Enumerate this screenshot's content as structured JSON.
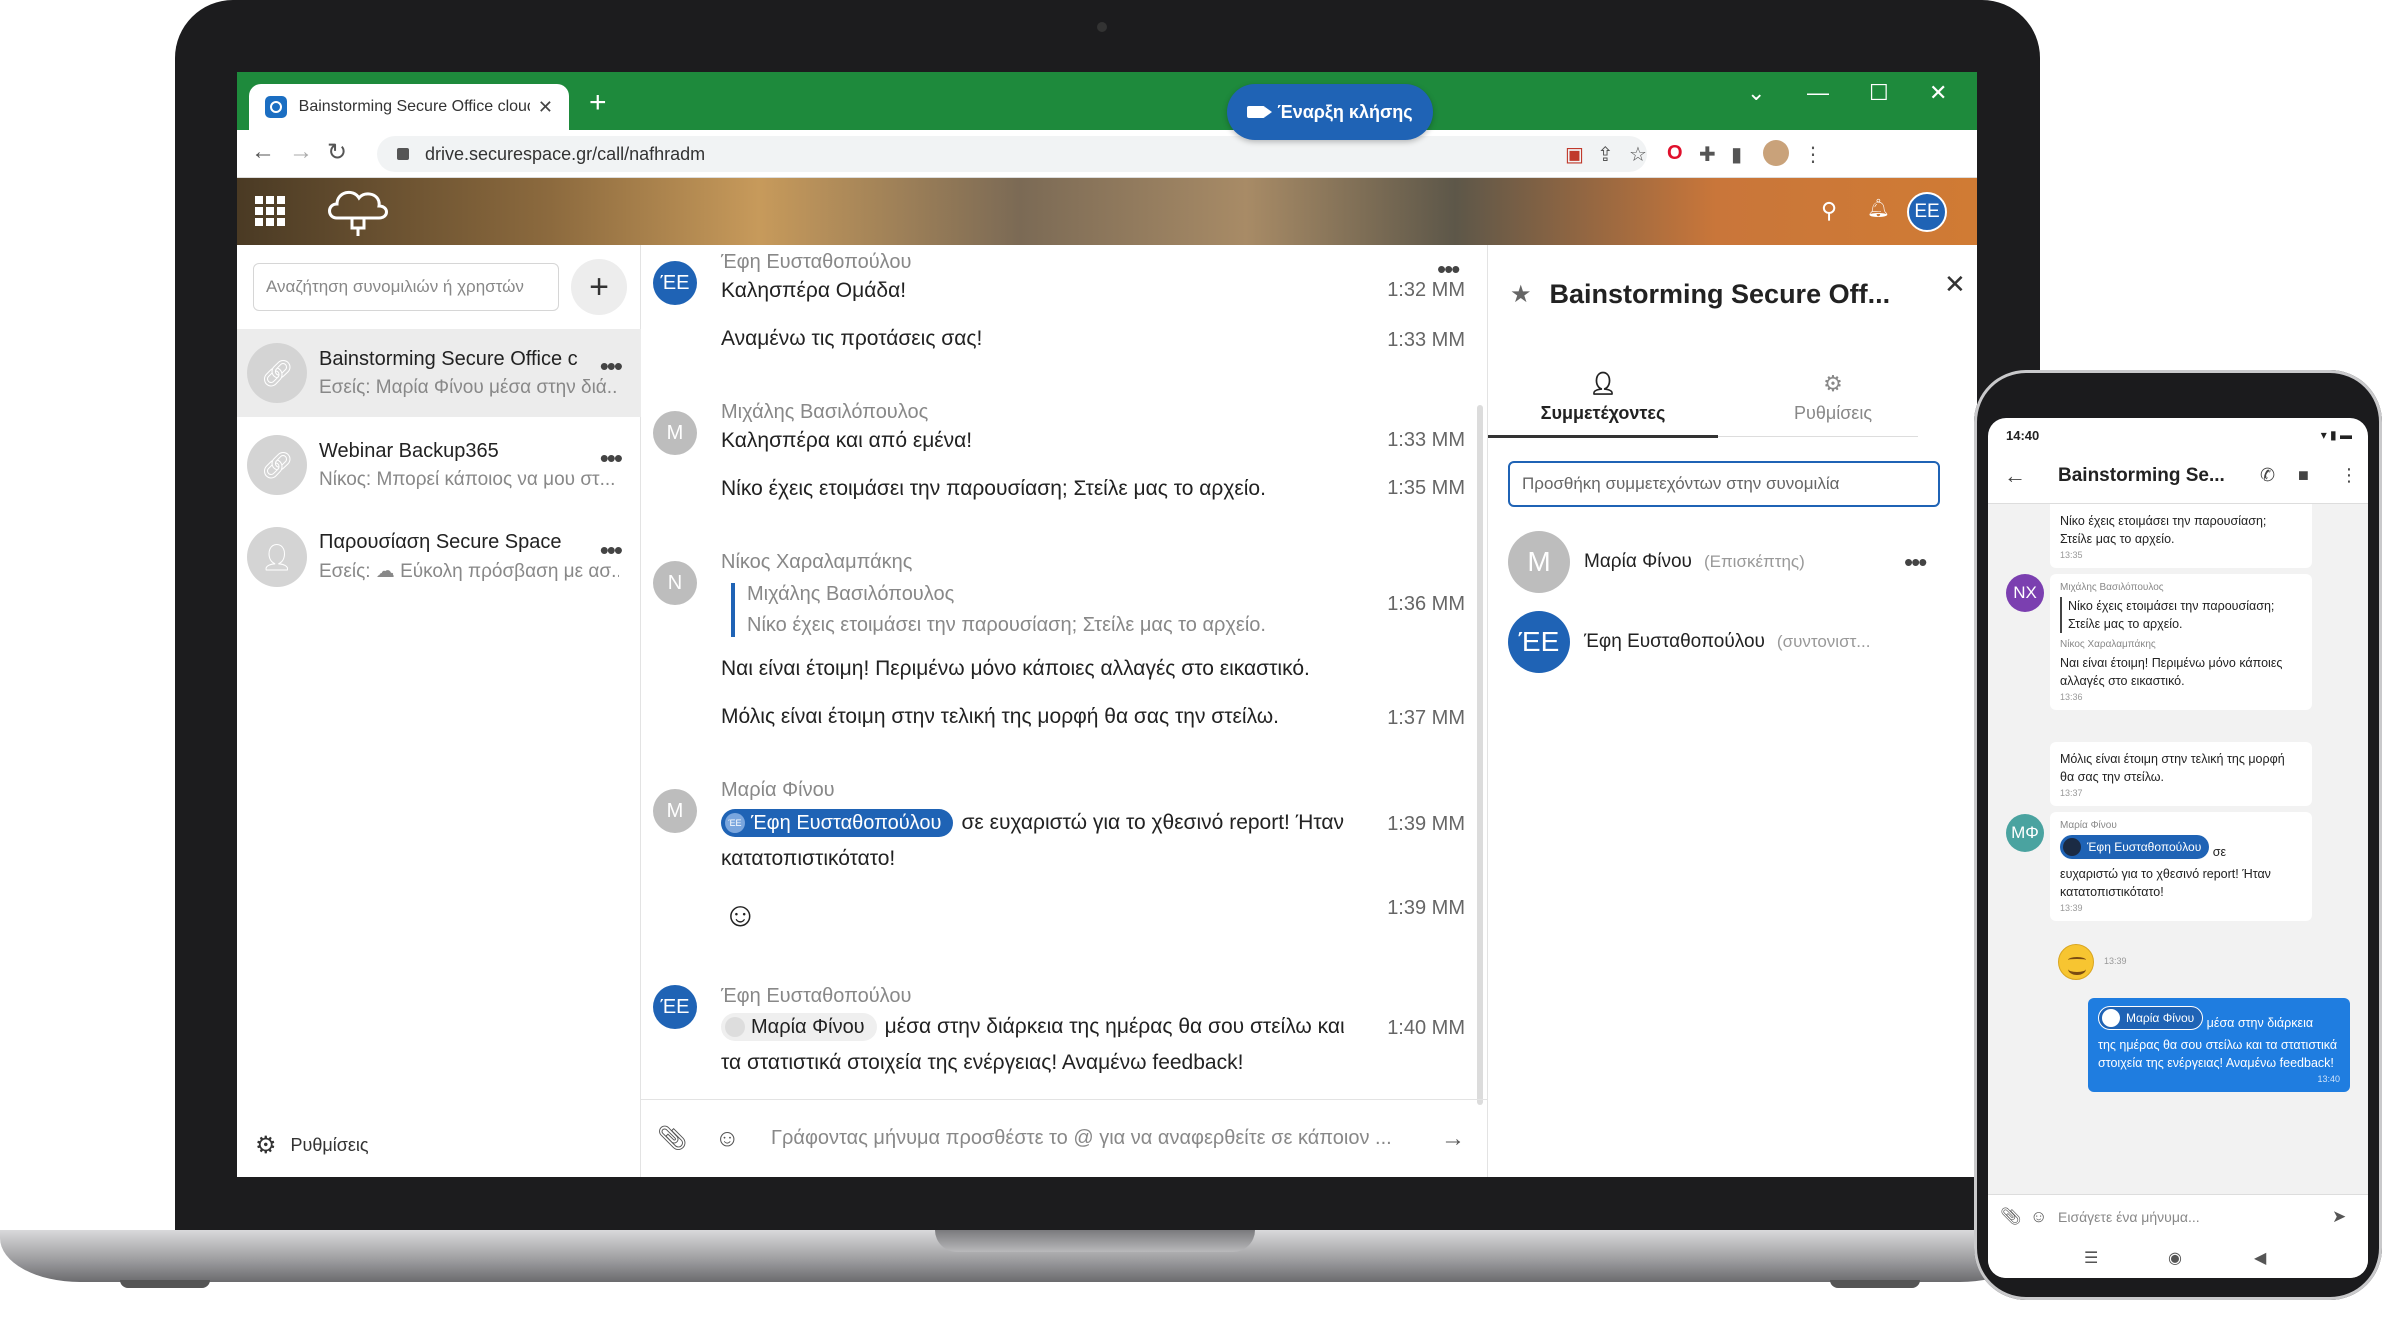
{
  "browser": {
    "tab_title": "Bainstorming Secure Office cloud",
    "tab_close": "✕",
    "new_tab": "+",
    "url": "drive.securespace.gr/call/nafhradm",
    "controls": {
      "chevron": "⌄",
      "minimize": "—",
      "maximize": "☐",
      "close": "✕"
    }
  },
  "app": {
    "header": {
      "avatar": "ΕΕ"
    }
  },
  "sidebar": {
    "search_placeholder": "Αναζήτηση συνομιλιών ή χρηστών",
    "add_label": "+",
    "conversations": [
      {
        "name": "Bainstorming Secure Office c...",
        "sub": "Εσείς: Μαρία Φίνου μέσα στην διά..."
      },
      {
        "name": "Webinar Backup365",
        "sub": "Νίκος: Μπορεί κάποιος να μου στ..."
      },
      {
        "name": "Παρουσίαση Secure Space",
        "sub": "Εσείς:  ☁ Εύκολη πρόσβαση με ασ..."
      }
    ],
    "settings_label": "Ρυθμίσεις"
  },
  "chat": {
    "call_button": "Έναρξη κλήσης",
    "messages": {
      "m1_author": "Έφη Ευσταθοπούλου",
      "m1_avatar": "ΈΕ",
      "m1_text": "Καλησπέρα Ομάδα!",
      "m1_time": "1:32 ΜΜ",
      "m2_text": "Αναμένω τις προτάσεις σας!",
      "m2_time": "1:33 ΜΜ",
      "m3_author": "Μιχάλης Βασιλόπουλος",
      "m3_avatar": "Μ",
      "m3_text": "Καλησπέρα και από εμένα!",
      "m3_time": "1:33 ΜΜ",
      "m4_text": "Νίκο έχεις ετοιμάσει την παρουσίαση; Στείλε μας το αρχείο.",
      "m4_time": "1:35 ΜΜ",
      "m5_author": "Νίκος Χαραλαμπάκης",
      "m5_avatar": "Ν",
      "m5_quote_author": "Μιχάλης Βασιλόπουλος",
      "m5_quote_text": "Νίκο έχεις ετοιμάσει την παρουσίαση; Στείλε μας το αρχείο.",
      "m5_text": "Ναι είναι έτοιμη! Περιμένω μόνο κάποιες αλλαγές στο εικαστικό.",
      "m5_time": "1:36 ΜΜ",
      "m6_text": "Μόλις είναι έτοιμη στην τελική της μορφή θα σας την στείλω.",
      "m6_time": "1:37 ΜΜ",
      "m7_author": "Μαρία Φίνου",
      "m7_avatar": "Μ",
      "m7_mention": "Έφη Ευσταθοπούλου",
      "m7_mention_av": "ΈΕ",
      "m7_text1": "σε ευχαριστώ για το χθεσινό report! Ήταν",
      "m7_text2": "κατατοπιστικότατο!",
      "m7_time": "1:39 ΜΜ",
      "m8_text": "☺",
      "m8_time": "1:39 ΜΜ",
      "m9_author": "Έφη Ευσταθοπούλου",
      "m9_avatar": "ΈΕ",
      "m9_mention": "Μαρία Φίνου",
      "m9_text1": "μέσα στην διάρκεια της ημέρας θα σου στείλω και",
      "m9_text2": "τα στατιστικά στοιχεία της ενέργειας! Αναμένω feedback!",
      "m9_time": "1:40 ΜΜ"
    },
    "composer_placeholder": "Γράφοντας μήνυμα προσθέστε το @ για να αναφερθείτε σε κάποιον ..."
  },
  "right_panel": {
    "title": "Bainstorming Secure Off...",
    "tabs": [
      "Συμμετέχοντες",
      "Ρυθμίσεις"
    ],
    "add_placeholder": "Προσθήκη συμμετεχόντων στην συνομιλία",
    "participants": [
      {
        "avatar": "Μ",
        "name": "Μαρία Φίνου",
        "role": "(Επισκέπτης)",
        "color": "#bdbdbd"
      },
      {
        "avatar": "ΈΕ",
        "name": "Έφη Ευσταθοπούλου",
        "role": "(συντονιστ...",
        "color": "#1f63b5"
      }
    ]
  },
  "phone": {
    "time": "14:40",
    "title": "Bainstorming Se...",
    "msgs": {
      "p1_text": "Νίκο έχεις ετοιμάσει την παρουσίαση; Στείλε μας το αρχείο.",
      "p1_time": "13:35",
      "p2_avatar": "NX",
      "p2_author": "Μιχάλης Βασιλόπουλος",
      "p2_quote": "Νίκο έχεις ετοιμάσει την παρουσίαση; Στείλε μας το αρχείο.",
      "p2_author2": "Νίκος Χαραλαμπάκης",
      "p2_text": "Ναι είναι έτοιμη! Περιμένω μόνο κάποιες αλλαγές στο εικαστικό.",
      "p2_time": "13:36",
      "p3_text": "Μόλις είναι έτοιμη στην τελική της μορφή θα σας την στείλω.",
      "p3_time": "13:37",
      "p4_avatar": "ΜΦ",
      "p4_author": "Μαρία Φίνου",
      "p4_mention": "Έφη Ευσταθοπούλου",
      "p4_after": "σε",
      "p4_text": "ευχαριστώ για το χθεσινό report! Ήταν κατατοπιστικότατο!",
      "p4_time": "13:39",
      "p5_time": "13:39",
      "p6_mention": "Μαρία Φίνου",
      "p6_after": "μέσα στην διάρκεια",
      "p6_text": "της ημέρας θα σου στείλω και τα στατιστικά στοιχεία της ενέργειας! Αναμένω feedback!",
      "p6_time": "13:40"
    },
    "composer_placeholder": "Εισάγετε ένα μήνυμα..."
  }
}
